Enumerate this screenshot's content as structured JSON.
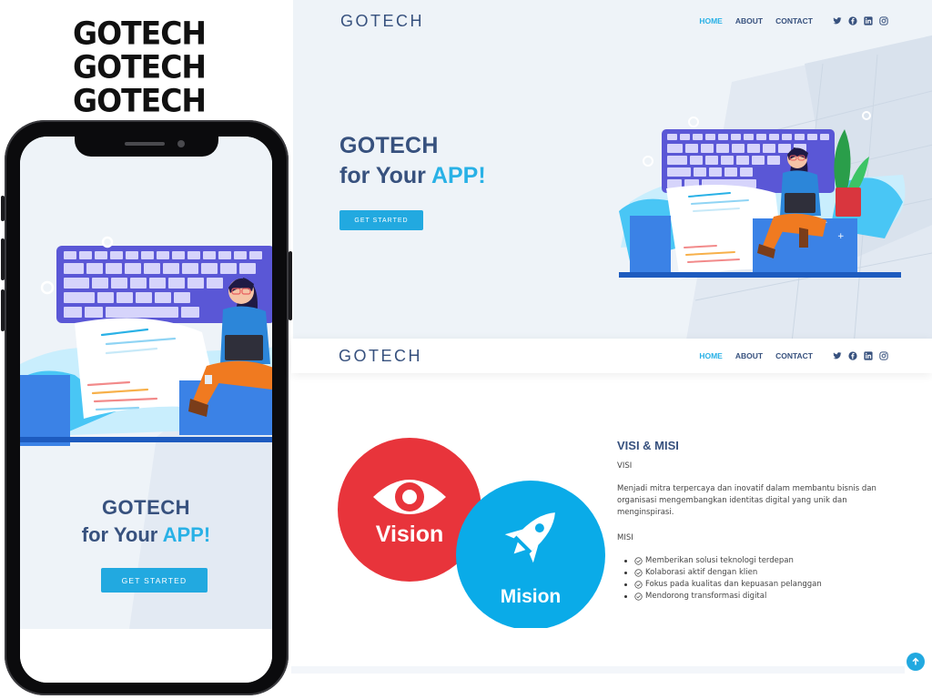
{
  "branding": {
    "lines": [
      "GOTECH",
      "GOTECH",
      "GOTECH"
    ]
  },
  "phone": {
    "hero_title_line1": "GOTECH",
    "hero_title_line2_prefix": "for Your",
    "hero_title_line2_accent": "APP!",
    "cta_label": "GET STARTED"
  },
  "desktop_hero": {
    "logo": "GOTECH",
    "nav": {
      "home": "HOME",
      "about": "ABOUT",
      "contact": "CONTACT"
    },
    "title_line1": "GOTECH",
    "title_line2_prefix": "for Your",
    "title_line2_accent": "APP!",
    "cta_label": "GET STARTED",
    "social_icons": [
      "twitter-icon",
      "facebook-icon",
      "linkedin-icon",
      "instagram-icon"
    ]
  },
  "desktop_section2": {
    "logo": "GOTECH",
    "nav": {
      "home": "HOME",
      "about": "ABOUT",
      "contact": "CONTACT"
    },
    "vision_label": "Vision",
    "mission_label": "Mision",
    "heading": "VISI & MISI",
    "visi_title": "VISI",
    "visi_text": "Menjadi mitra terpercaya dan inovatif dalam membantu bisnis dan organisasi mengembangkan identitas digital yang unik dan menginspirasi.",
    "misi_title": "MISI",
    "misi_items": [
      "Memberikan solusi teknologi terdepan",
      "Kolaborasi aktif dengan klien",
      "Fokus pada kualitas dan kepuasan pelanggan",
      "Mendorong transformasi digital"
    ]
  },
  "colors": {
    "primary": "#37517e",
    "accent": "#29b1e6",
    "button": "#22a9e0",
    "vision_red": "#e8343b",
    "mission_blue": "#0aabe8"
  }
}
